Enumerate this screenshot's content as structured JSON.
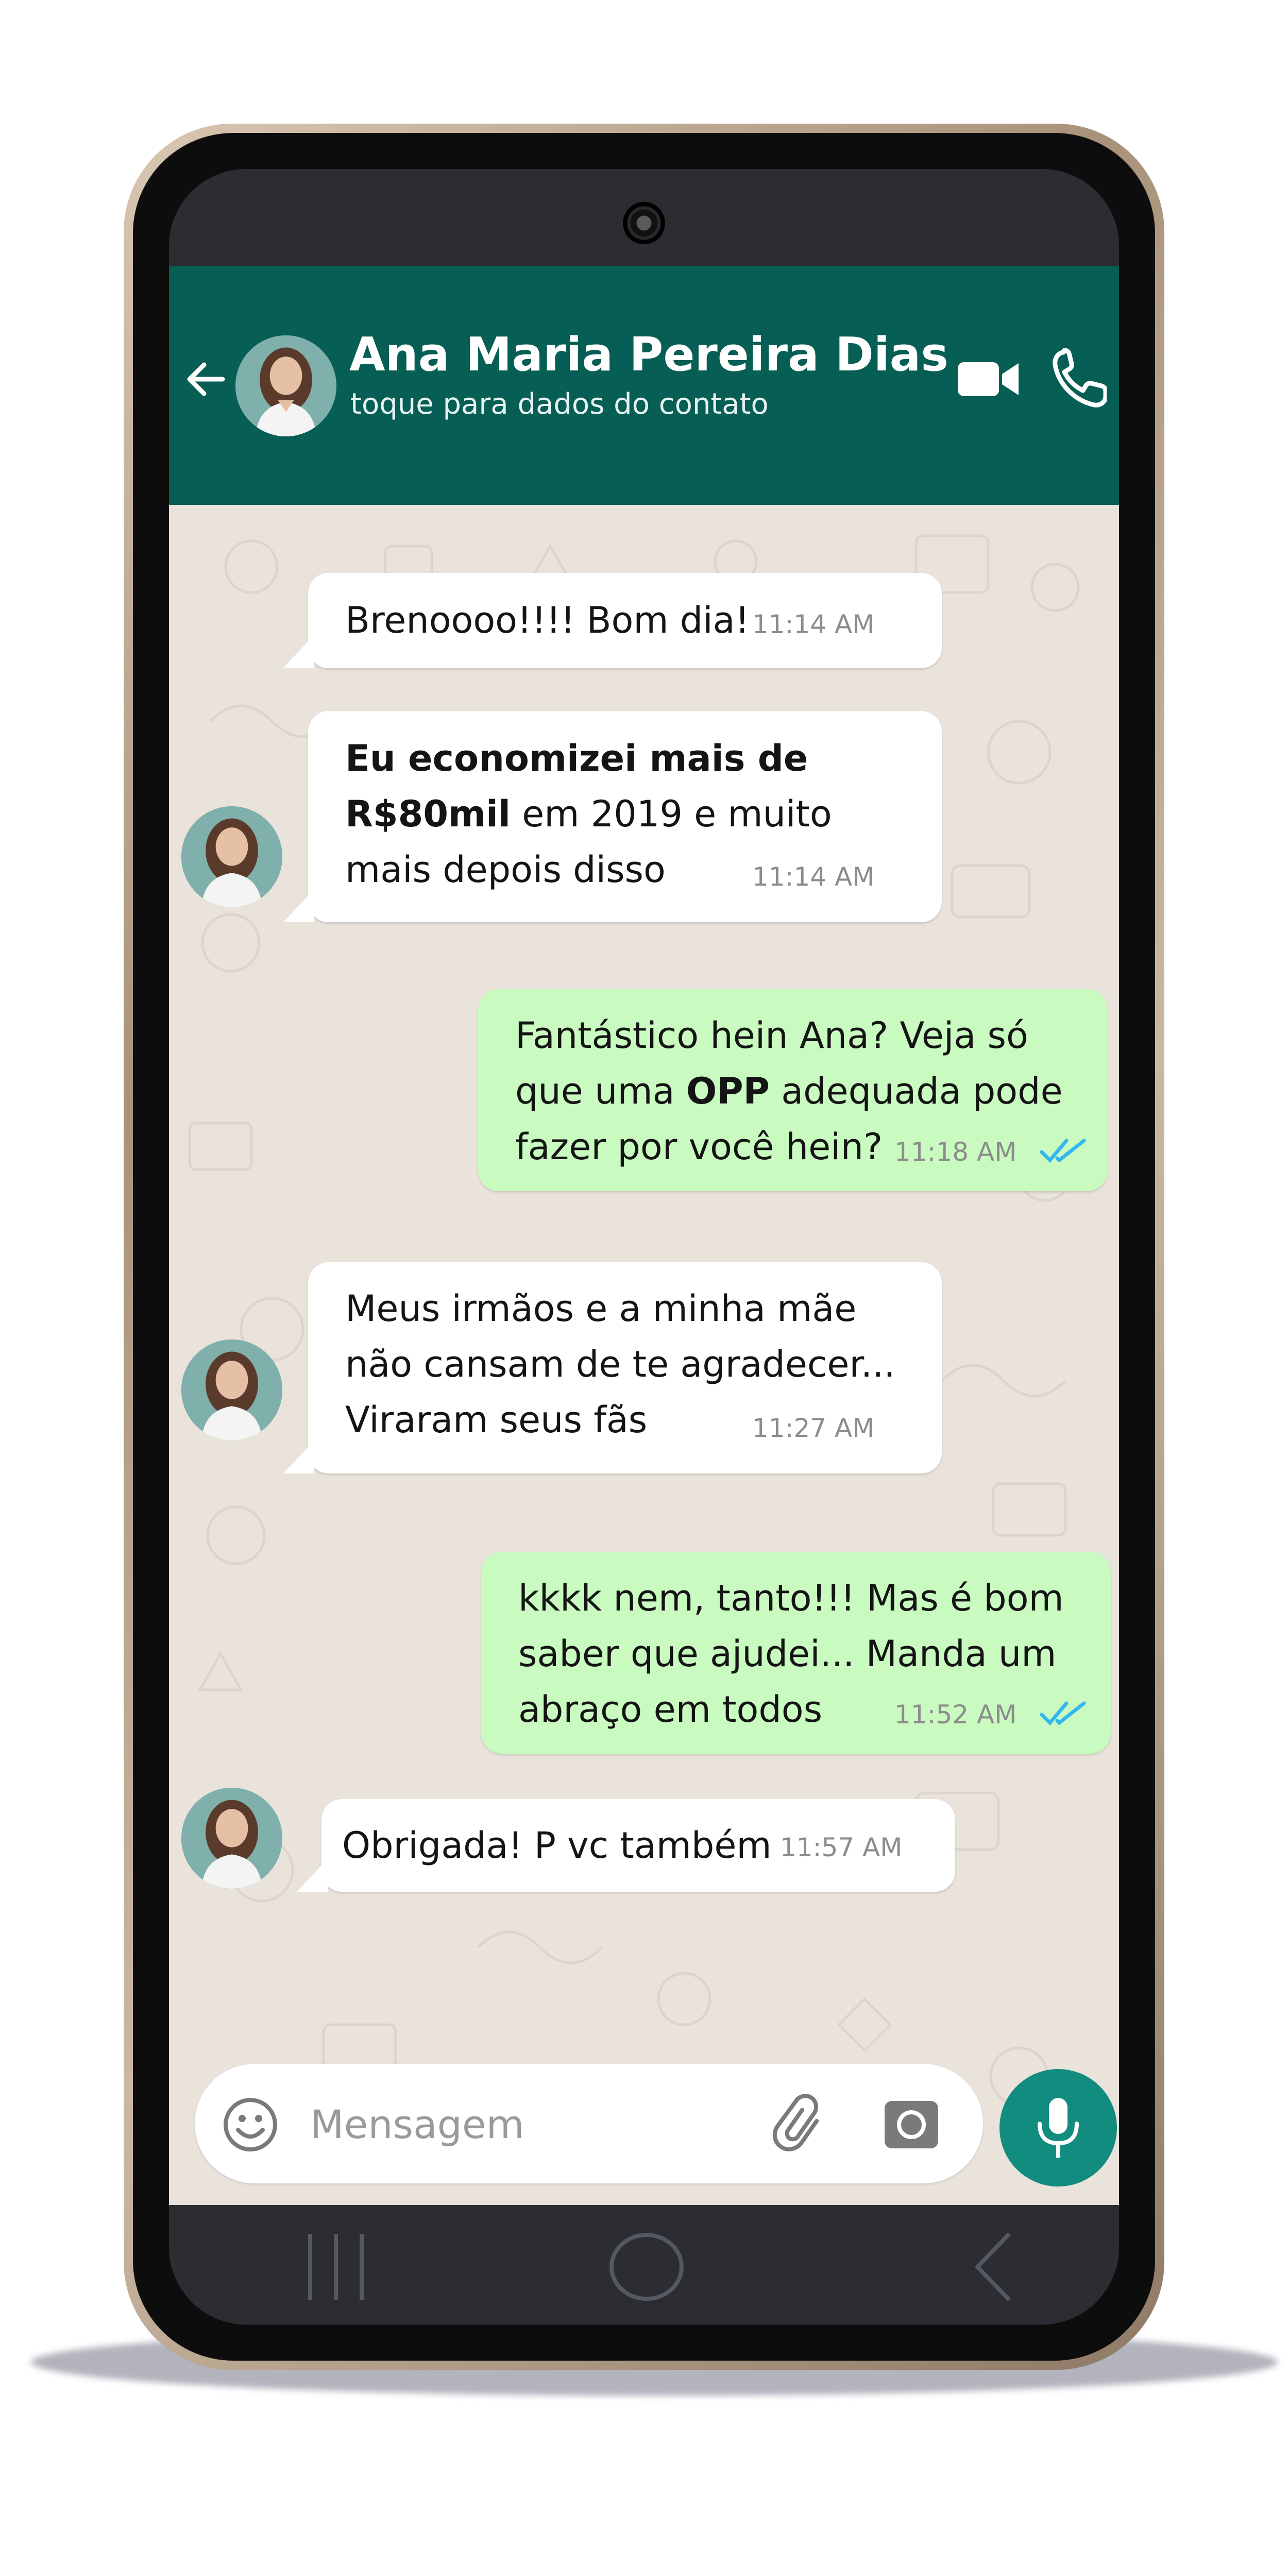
{
  "header": {
    "contact_name": "Ana Maria Pereira Dias",
    "subtitle": "toque para dados do contato"
  },
  "messages": [
    {
      "direction": "in",
      "html_text": "Brenoooo!!!! Bom dia!",
      "time": "11:14 AM"
    },
    {
      "direction": "in",
      "lines": [
        "Eu economizei mais de",
        "R$80mil em 2019 e muito",
        "mais depois disso"
      ],
      "bold_spans": [
        "Eu economizei mais de",
        "R$80mil"
      ],
      "time": "11:14 AM"
    },
    {
      "direction": "out",
      "lines": [
        "Fantástico hein Ana? Veja só",
        "que uma OPP adequada pode",
        "fazer por você hein?"
      ],
      "bold_spans": [
        "OPP"
      ],
      "time": "11:18 AM"
    },
    {
      "direction": "in",
      "lines": [
        "Meus irmãos e a minha mãe",
        "não cansam de te agradecer...",
        "Viraram seus fãs"
      ],
      "time": "11:27 AM"
    },
    {
      "direction": "out",
      "lines": [
        "kkkk nem, tanto!!! Mas é bom",
        "saber que ajudei... Manda um",
        "abraço em todos"
      ],
      "time": "11:52 AM"
    },
    {
      "direction": "in",
      "html_text": "Obrigada! P vc também",
      "time": "11:57 AM"
    }
  ],
  "composer": {
    "placeholder": "Mensagem"
  },
  "icons": {
    "back": "arrow-left-icon",
    "video": "video-camera-icon",
    "call": "phone-icon",
    "emoji": "smiley-icon",
    "attach": "paperclip-icon",
    "camera": "camera-icon",
    "mic": "microphone-icon",
    "read_receipt": "double-check-icon"
  },
  "colors": {
    "header": "#075e54",
    "outgoing_bubble": "#c9fbc0",
    "incoming_bubble": "#ffffff",
    "chat_background": "#e9e3dc",
    "mic_button": "#128c7e",
    "read_ticks": "#34b7f1"
  }
}
